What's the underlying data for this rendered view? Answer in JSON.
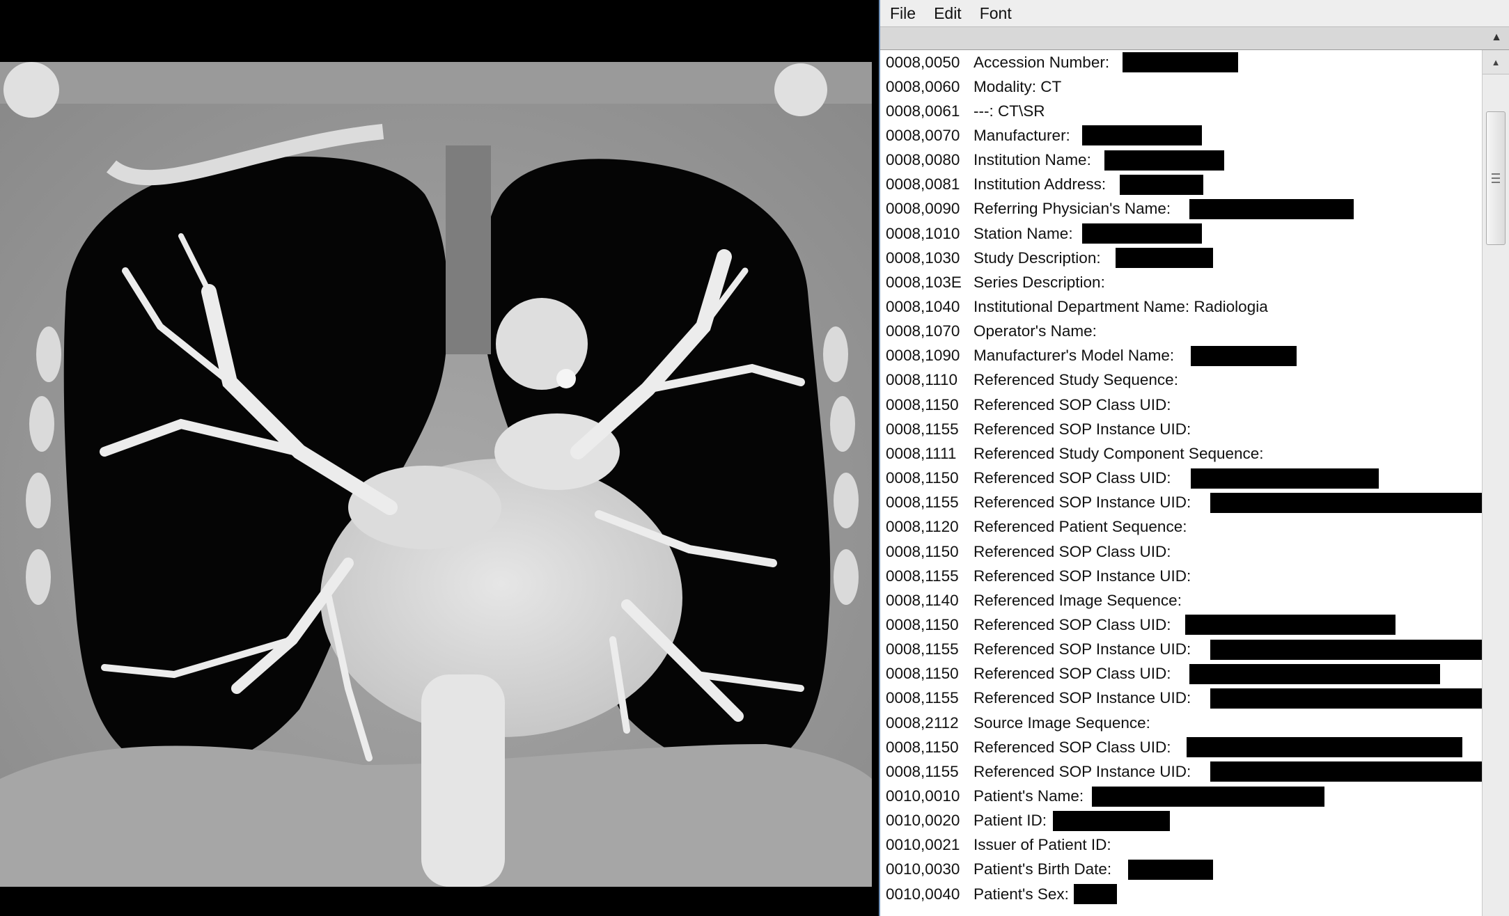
{
  "menu": {
    "file": "File",
    "edit": "Edit",
    "font": "Font"
  },
  "image": {
    "description": "Coronal chest CT image"
  },
  "tags": [
    {
      "code": "0008,0050",
      "desc": "Accession Number:",
      "value": "",
      "redacted": true
    },
    {
      "code": "0008,0060",
      "desc": "Modality: CT",
      "value": "CT",
      "redacted": false
    },
    {
      "code": "0008,0061",
      "desc": "---: CT\\SR",
      "value": "CT\\SR",
      "redacted": false
    },
    {
      "code": "0008,0070",
      "desc": "Manufacturer:",
      "value": "",
      "redacted": true
    },
    {
      "code": "0008,0080",
      "desc": "Institution Name:",
      "value": "",
      "redacted": true
    },
    {
      "code": "0008,0081",
      "desc": "Institution Address:",
      "value": "",
      "redacted": true
    },
    {
      "code": "0008,0090",
      "desc": "Referring Physician's Name:",
      "value": "",
      "redacted": true
    },
    {
      "code": "0008,1010",
      "desc": "Station Name:",
      "value": "",
      "redacted": true
    },
    {
      "code": "0008,1030",
      "desc": "Study Description:",
      "value": "",
      "redacted": true
    },
    {
      "code": "0008,103E",
      "desc": "Series Description:",
      "value": "",
      "redacted": false
    },
    {
      "code": "0008,1040",
      "desc": "Institutional Department Name: Radiologia",
      "value": "Radiologia",
      "redacted": false
    },
    {
      "code": "0008,1070",
      "desc": "Operator's Name:",
      "value": "",
      "redacted": false
    },
    {
      "code": "0008,1090",
      "desc": "Manufacturer's Model Name:",
      "value": "",
      "redacted": true
    },
    {
      "code": "0008,1110",
      "desc": "Referenced Study Sequence:",
      "value": "",
      "redacted": false
    },
    {
      "code": "0008,1150",
      "desc": "Referenced SOP Class UID:",
      "value": "",
      "redacted": false
    },
    {
      "code": "0008,1155",
      "desc": "Referenced SOP Instance UID:",
      "value": "",
      "redacted": false
    },
    {
      "code": "0008,1111",
      "desc": "Referenced Study Component Sequence:",
      "value": "",
      "redacted": false
    },
    {
      "code": "0008,1150",
      "desc": "Referenced SOP Class UID:",
      "value": "",
      "redacted": true
    },
    {
      "code": "0008,1155",
      "desc": "Referenced SOP Instance UID:",
      "value": "",
      "redacted": true
    },
    {
      "code": "0008,1120",
      "desc": "Referenced Patient Sequence:",
      "value": "",
      "redacted": false
    },
    {
      "code": "0008,1150",
      "desc": "Referenced SOP Class UID:",
      "value": "",
      "redacted": false
    },
    {
      "code": "0008,1155",
      "desc": "Referenced SOP Instance UID:",
      "value": "",
      "redacted": false
    },
    {
      "code": "0008,1140",
      "desc": "Referenced Image Sequence:",
      "value": "",
      "redacted": false
    },
    {
      "code": "0008,1150",
      "desc": "Referenced SOP Class UID:",
      "value": "",
      "redacted": true
    },
    {
      "code": "0008,1155",
      "desc": "Referenced SOP Instance UID:",
      "value": "",
      "redacted": true
    },
    {
      "code": "0008,1150",
      "desc": "Referenced SOP Class UID:",
      "value": "",
      "redacted": true
    },
    {
      "code": "0008,1155",
      "desc": "Referenced SOP Instance UID:",
      "value": "",
      "redacted": true
    },
    {
      "code": "0008,2112",
      "desc": "Source Image Sequence:",
      "value": "",
      "redacted": false
    },
    {
      "code": "0008,1150",
      "desc": "Referenced SOP Class UID:",
      "value": "",
      "redacted": true
    },
    {
      "code": "0008,1155",
      "desc": "Referenced SOP Instance UID:",
      "value": "",
      "redacted": true
    },
    {
      "code": "0010,0010",
      "desc": "Patient's Name:",
      "value": "",
      "redacted": true
    },
    {
      "code": "0010,0020",
      "desc": "Patient ID:",
      "value": "",
      "redacted": true
    },
    {
      "code": "0010,0021",
      "desc": "Issuer of Patient ID:",
      "value": "",
      "redacted": false
    },
    {
      "code": "0010,0030",
      "desc": "Patient's Birth Date:",
      "value": "",
      "redacted": true
    },
    {
      "code": "0010,0040",
      "desc": "Patient's Sex:",
      "value": "",
      "redacted": true
    }
  ],
  "colors": {
    "window_border": "#6d8fb7",
    "menubar_bg": "#eeeeee",
    "text": "#111111",
    "redaction": "#000000"
  },
  "icons": {
    "scroll_up": "arrow-up-icon",
    "strip_arrow": "arrow-up-icon",
    "scroll_grip": "grip-icon"
  }
}
